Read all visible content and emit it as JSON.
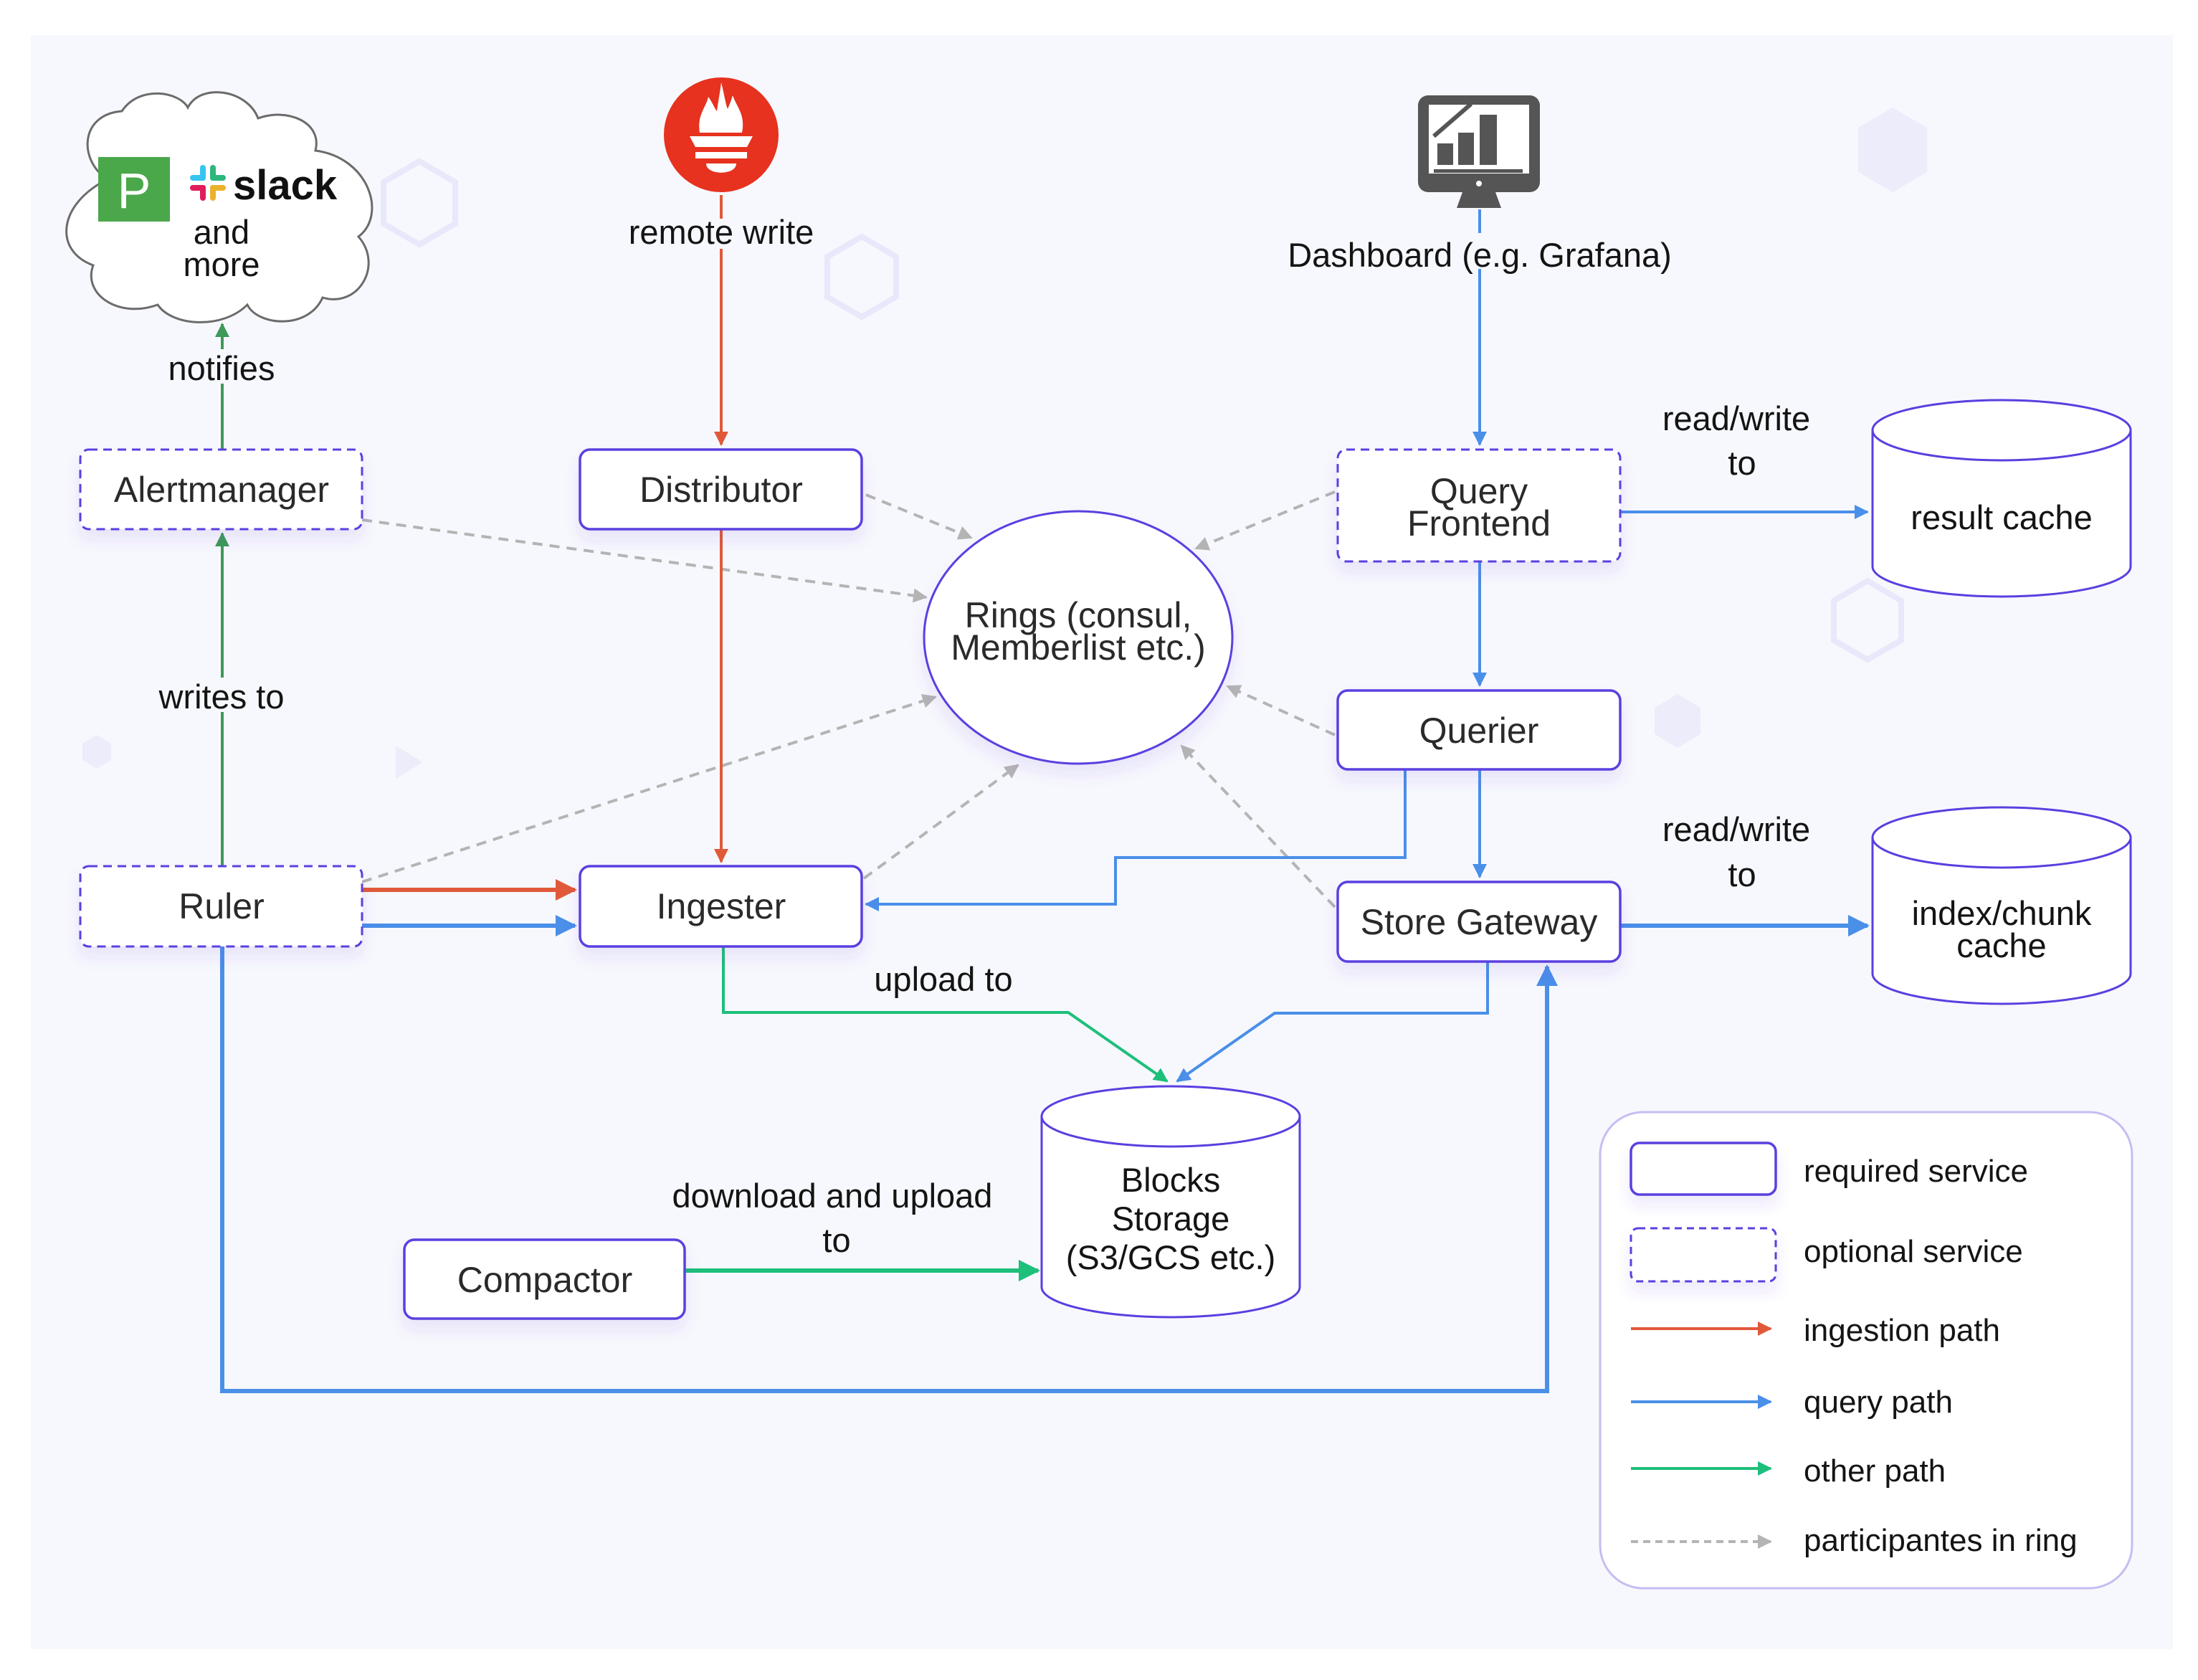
{
  "colors": {
    "background_panel": "#f7f8fd",
    "node_border": "#5a3fe0",
    "ingestion": "#e05a3a",
    "query": "#4a8fe8",
    "other": "#1dbf7a",
    "notify_green": "#3e9a58",
    "ring": "#b4b4b4",
    "prometheus": "#e6321e",
    "pagerduty": "#4aa84a",
    "dashboard_icon": "#555555",
    "legend_border": "#c6bdf2"
  },
  "external": {
    "cloud": {
      "pagerduty_letter": "P",
      "slack_label": "slack",
      "line1": "and",
      "line2": "more"
    },
    "prometheus": {
      "icon": "prometheus-torch-icon",
      "label": "remote write"
    },
    "dashboard": {
      "icon": "monitor-chart-icon",
      "label": "Dashboard (e.g. Grafana)"
    }
  },
  "nodes": {
    "alertmanager": {
      "label": "Alertmanager",
      "type": "optional"
    },
    "distributor": {
      "label": "Distributor",
      "type": "required"
    },
    "query_frontend": {
      "line1": "Query",
      "line2": "Frontend",
      "type": "optional"
    },
    "rings": {
      "line1": "Rings (consul,",
      "line2": "Memberlist etc.)"
    },
    "querier": {
      "label": "Querier",
      "type": "required"
    },
    "ruler": {
      "label": "Ruler",
      "type": "optional"
    },
    "ingester": {
      "label": "Ingester",
      "type": "required"
    },
    "store_gateway": {
      "label": "Store Gateway",
      "type": "required"
    },
    "compactor": {
      "label": "Compactor",
      "type": "required"
    },
    "result_cache": {
      "label": "result cache"
    },
    "index_chunk_cache": {
      "line1": "index/chunk",
      "line2": "cache"
    },
    "blocks_storage": {
      "line1": "Blocks",
      "line2": "Storage",
      "line3": "(S3/GCS etc.)"
    }
  },
  "edge_labels": {
    "notifies": "notifies",
    "writes_to": "writes to",
    "read_write_result": {
      "line1": "read/write",
      "line2": "to"
    },
    "read_write_index": {
      "line1": "read/write",
      "line2": "to"
    },
    "upload_to": "upload to",
    "download_upload": {
      "line1": "download and upload",
      "line2": "to"
    }
  },
  "legend": {
    "items": [
      {
        "kind": "required-box",
        "label": "required service"
      },
      {
        "kind": "optional-box",
        "label": "optional service"
      },
      {
        "kind": "ingestion-arrow",
        "label": "ingestion path"
      },
      {
        "kind": "query-arrow",
        "label": "query path"
      },
      {
        "kind": "other-arrow",
        "label": "other path"
      },
      {
        "kind": "ring-arrow",
        "label": "participantes in ring"
      }
    ]
  }
}
